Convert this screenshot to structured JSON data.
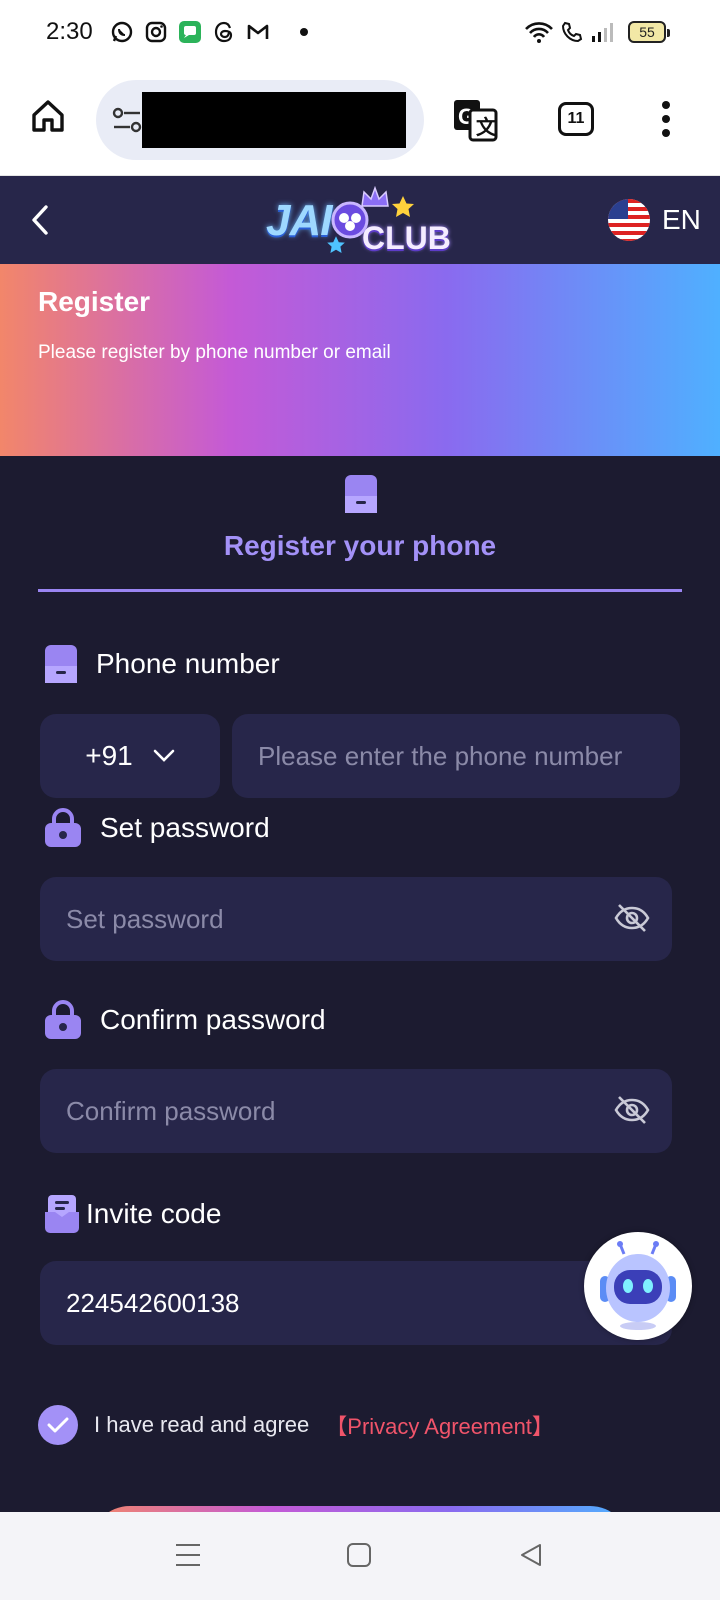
{
  "status_bar": {
    "time": "2:30",
    "battery": "55",
    "notification_icons": [
      "whatsapp-icon",
      "instagram-icon",
      "messages-icon",
      "threads-icon",
      "gmail-icon",
      "dot-icon"
    ],
    "system_icons": [
      "wifi-icon",
      "wifi-calling-icon",
      "signal-icon",
      "battery-icon"
    ]
  },
  "browser": {
    "url_redacted": true,
    "tab_count": "11"
  },
  "header": {
    "logo_text_1": "JAI",
    "logo_text_2": "CLUB",
    "language": "EN"
  },
  "banner": {
    "title": "Register",
    "subtitle": "Please register by phone number or email"
  },
  "tab": {
    "label": "Register your phone"
  },
  "form": {
    "phone_label": "Phone number",
    "country_code": "+91",
    "phone_placeholder": "Please enter the phone number",
    "password_label": "Set password",
    "password_placeholder": "Set password",
    "confirm_label": "Confirm password",
    "confirm_placeholder": "Confirm password",
    "invite_label": "Invite code",
    "invite_value": "224542600138"
  },
  "agreement": {
    "text": "I have read and agree",
    "link": "【Privacy Agreement】",
    "checked": true
  },
  "colors": {
    "accent": "#a391f7",
    "background": "#1c1b30",
    "input_bg": "#27264a",
    "link": "#f0546a"
  }
}
